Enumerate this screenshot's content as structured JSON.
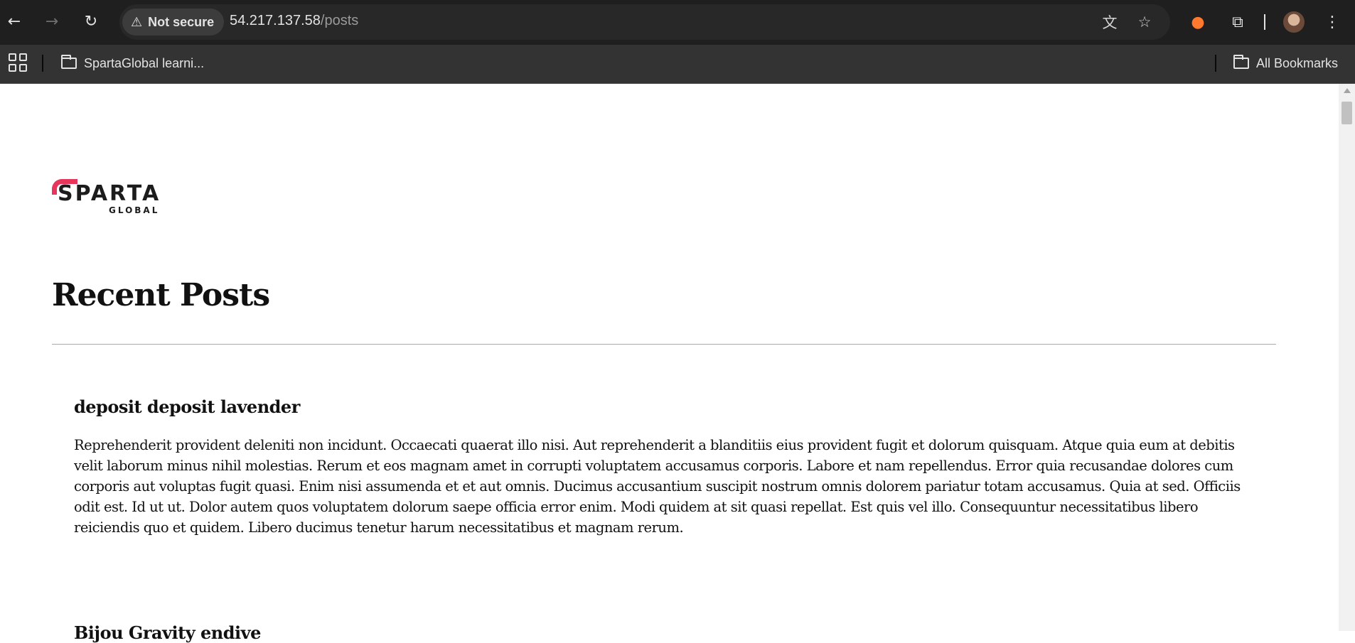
{
  "browser": {
    "security_label": "Not secure",
    "url_host": "54.217.137.58",
    "url_path": "/posts",
    "bookmarks": [
      {
        "label": "SpartaGlobal learni..."
      },
      {
        "label": "All Bookmarks"
      }
    ]
  },
  "page": {
    "logo_text": "SPARTA",
    "logo_subtext": "GLOBAL",
    "title": "Recent Posts",
    "posts": [
      {
        "title": "deposit deposit lavender",
        "body": "Reprehenderit provident deleniti non incidunt. Occaecati quaerat illo nisi. Aut reprehenderit a blanditiis eius provident fugit et dolorum quisquam. Atque quia eum at debitis velit laborum minus nihil molestias. Rerum et eos magnam amet in corrupti voluptatem accusamus corporis. Labore et nam repellendus. Error quia recusandae dolores cum corporis aut voluptas fugit quasi. Enim nisi assumenda et et aut omnis. Ducimus accusantium suscipit nostrum omnis dolorem pariatur totam accusamus. Quia at sed. Officiis odit est. Id ut ut. Dolor autem quos voluptatem dolorum saepe officia error enim. Modi quidem at sit quasi repellat. Est quis vel illo. Consequuntur necessitatibus libero reiciendis quo et quidem. Libero ducimus tenetur harum necessitatibus et magnam rerum."
      },
      {
        "title": "Bijou Gravity endive"
      }
    ]
  },
  "colors": {
    "brand_accent": "#e8355b",
    "chrome_bg": "#1f1f1f",
    "bookmarks_bg": "#333333"
  }
}
